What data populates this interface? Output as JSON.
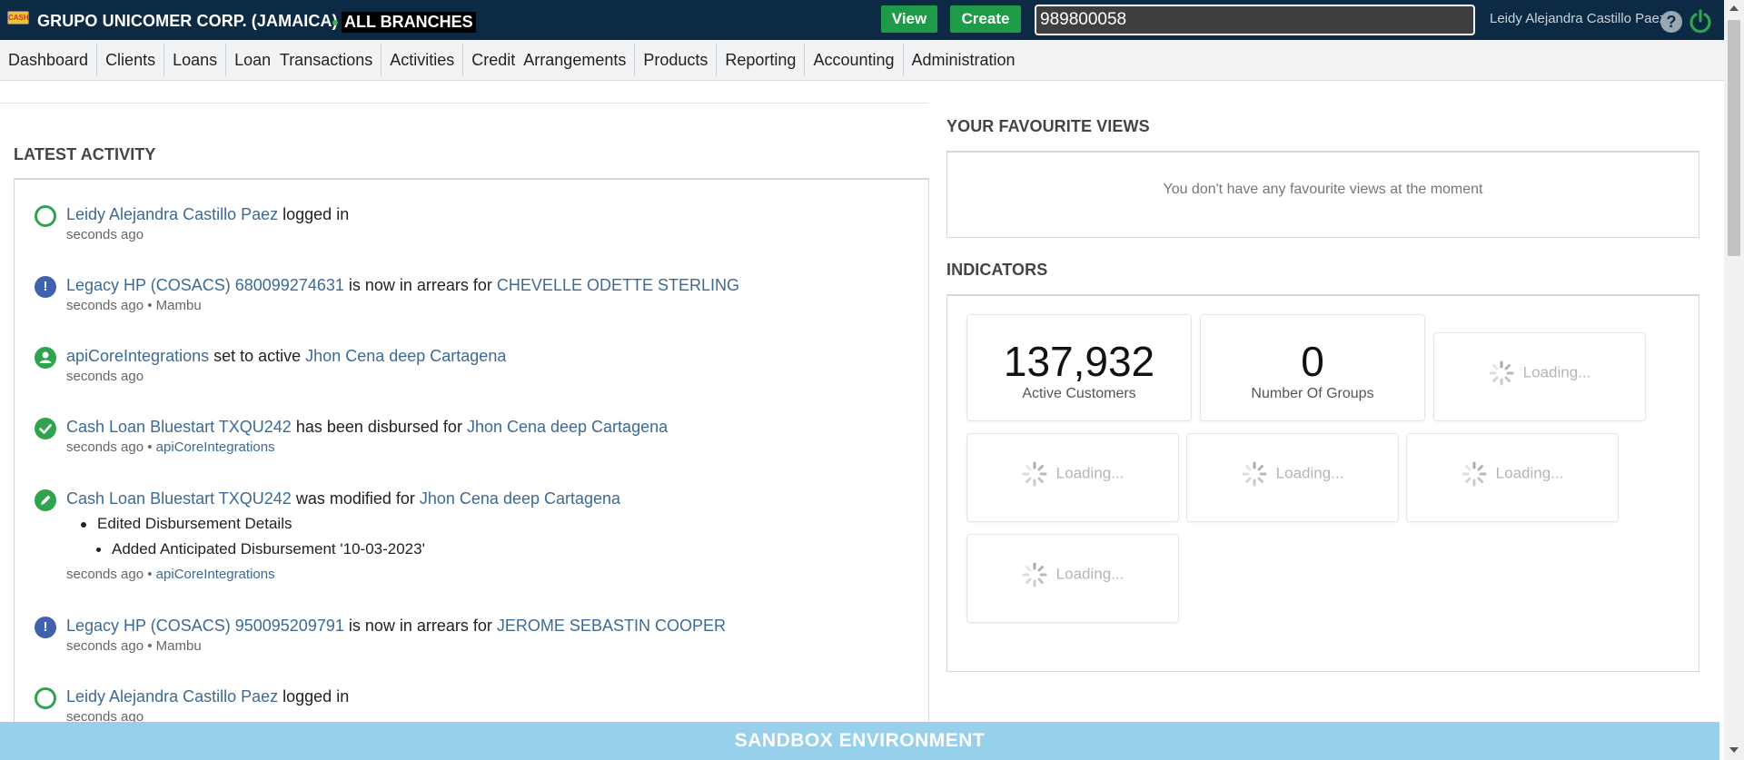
{
  "header": {
    "logo_text": "CASH",
    "org_name": "GRUPO UNICOMER CORP. (JAMAICA)",
    "branch": "ALL BRANCHES",
    "view_label": "View",
    "create_label": "Create",
    "search_value": "989800058",
    "user_name": "Leidy Alejandra Castillo Paez",
    "help_label": "?",
    "colors": {
      "bg": "#0c2a43",
      "button": "#1e9a48",
      "power": "#2ea44f"
    }
  },
  "nav": {
    "items": [
      "Dashboard",
      "Clients",
      "Loans",
      "Loan  Transactions",
      "Activities",
      "Credit  Arrangements",
      "Products",
      "Reporting",
      "Accounting",
      "Administration"
    ]
  },
  "latest_activity": {
    "title": "LATEST ACTIVITY",
    "items": [
      {
        "icon": "power-icon",
        "link1": "Leidy Alejandra Castillo Paez",
        "text1": " logged in",
        "time": "seconds ago"
      },
      {
        "icon": "alert-icon",
        "link1": "Legacy HP (COSACS) 680099274631",
        "text1": " is now in arrears for ",
        "link2": "CHEVELLE ODETTE STERLING",
        "time": "seconds ago",
        "sep": " • ",
        "source": "Mambu"
      },
      {
        "icon": "user-icon",
        "link1": "apiCoreIntegrations",
        "text1": " set to active ",
        "link2": "Jhon Cena deep Cartagena",
        "time": "seconds ago"
      },
      {
        "icon": "check-icon",
        "link1": "Cash Loan Bluestart TXQU242",
        "text1": " has been disbursed for ",
        "link2": "Jhon Cena deep Cartagena",
        "time": "seconds ago",
        "sep": " • ",
        "source": "apiCoreIntegrations"
      },
      {
        "icon": "edit-icon",
        "link1": "Cash Loan Bluestart TXQU242",
        "text1": " was modified for ",
        "link2": "Jhon Cena deep Cartagena",
        "sub1": "Edited Disbursement Details",
        "sub2": "Added Anticipated Disbursement '10-03-2023'",
        "time": "seconds ago",
        "sep": " • ",
        "source": "apiCoreIntegrations"
      },
      {
        "icon": "alert-icon",
        "link1": "Legacy HP (COSACS) 950095209791",
        "text1": " is now in arrears for ",
        "link2": "JEROME SEBASTIN COOPER",
        "time": "seconds ago",
        "sep": " • ",
        "source": "Mambu"
      },
      {
        "icon": "power-icon",
        "link1": "Leidy Alejandra Castillo Paez",
        "text1": " logged in",
        "time": "seconds ago"
      }
    ]
  },
  "favourites": {
    "title": "YOUR FAVOURITE VIEWS",
    "empty_text": "You don't have any favourite views at the moment"
  },
  "indicators": {
    "title": "INDICATORS",
    "tiles": [
      {
        "value": "137,932",
        "label": "Active Customers"
      },
      {
        "value": "0",
        "label": "Number Of Groups"
      }
    ],
    "loading_text": "Loading..."
  },
  "sandbox": {
    "label": "SANDBOX ENVIRONMENT",
    "color": "#96d0ea"
  }
}
